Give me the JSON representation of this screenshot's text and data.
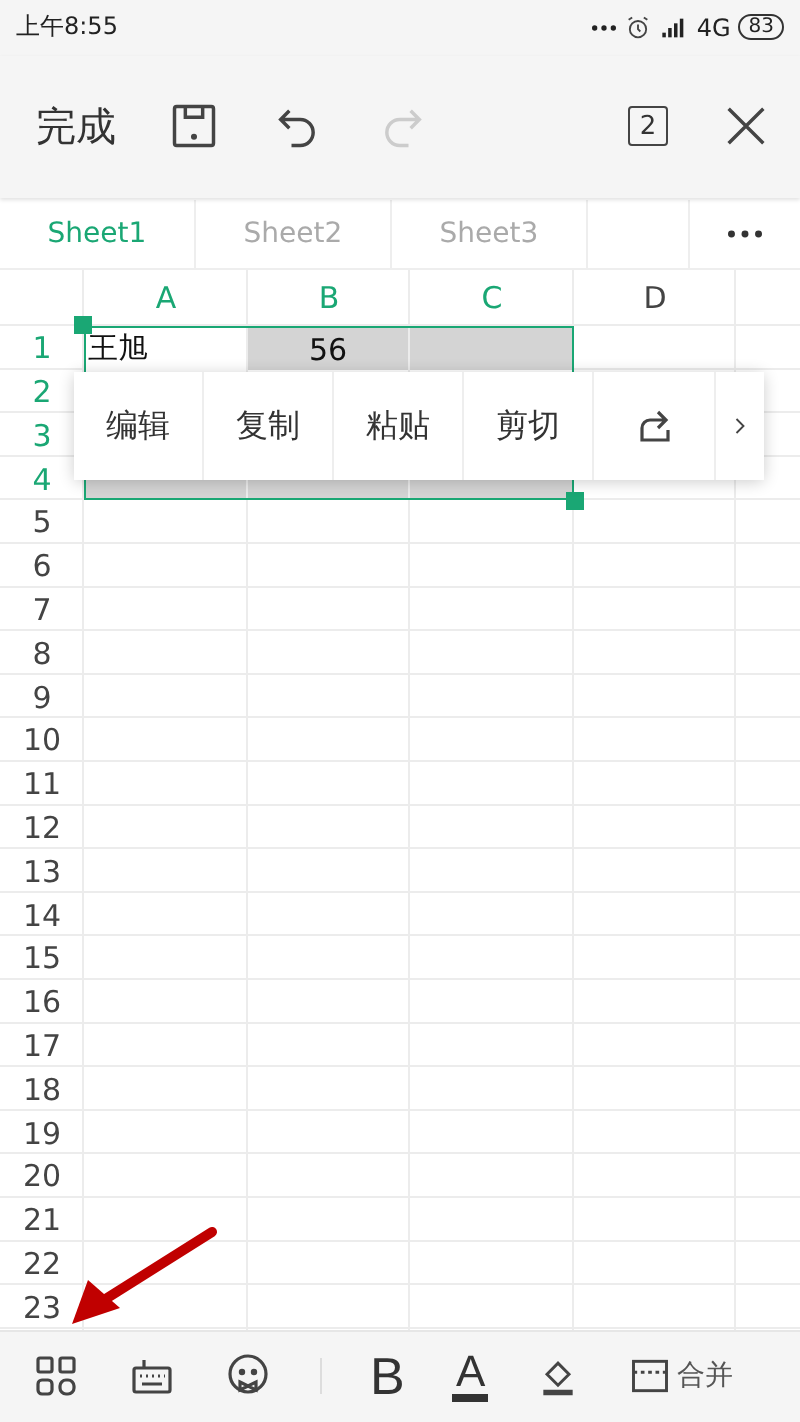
{
  "status_bar": {
    "time": "上午8:55",
    "network": "4G",
    "battery": "83"
  },
  "toolbar": {
    "done_label": "完成",
    "redo_enabled": false,
    "window_count": "2"
  },
  "tabs": [
    {
      "label": "Sheet1",
      "selected": true
    },
    {
      "label": "Sheet2",
      "selected": false
    },
    {
      "label": "Sheet3",
      "selected": false
    }
  ],
  "columns": [
    {
      "label": "A",
      "selected": true
    },
    {
      "label": "B",
      "selected": true
    },
    {
      "label": "C",
      "selected": true
    },
    {
      "label": "D",
      "selected": false
    }
  ],
  "rows": [
    {
      "number": "1",
      "selected": true,
      "cells": [
        {
          "text": "王旭",
          "highlighted": false
        },
        {
          "text": "56",
          "highlighted": true
        },
        {
          "highlighted": true
        }
      ]
    },
    {
      "number": "2",
      "selected": true
    },
    {
      "number": "3",
      "selected": true
    },
    {
      "number": "4",
      "selected": true,
      "cells": [
        {
          "highlighted": true
        },
        {
          "highlighted": true
        },
        {
          "highlighted": true
        }
      ]
    },
    {
      "number": "5",
      "selected": false
    },
    {
      "number": "6",
      "selected": false
    },
    {
      "number": "7",
      "selected": false
    },
    {
      "number": "8",
      "selected": false
    },
    {
      "number": "9",
      "selected": false
    },
    {
      "number": "10",
      "selected": false
    },
    {
      "number": "11",
      "selected": false
    },
    {
      "number": "12",
      "selected": false
    },
    {
      "number": "13",
      "selected": false
    },
    {
      "number": "14",
      "selected": false
    },
    {
      "number": "15",
      "selected": false
    },
    {
      "number": "16",
      "selected": false
    },
    {
      "number": "17",
      "selected": false
    },
    {
      "number": "18",
      "selected": false
    },
    {
      "number": "19",
      "selected": false
    },
    {
      "number": "20",
      "selected": false
    },
    {
      "number": "21",
      "selected": false
    },
    {
      "number": "22",
      "selected": false
    },
    {
      "number": "23",
      "selected": false
    }
  ],
  "context_menu": {
    "items": [
      {
        "label": "编辑"
      },
      {
        "label": "复制"
      },
      {
        "label": "粘贴"
      },
      {
        "label": "剪切"
      }
    ]
  },
  "bottom_toolbar": {
    "bold_label": "B",
    "font_color_label": "A",
    "merge_label": "合并"
  }
}
